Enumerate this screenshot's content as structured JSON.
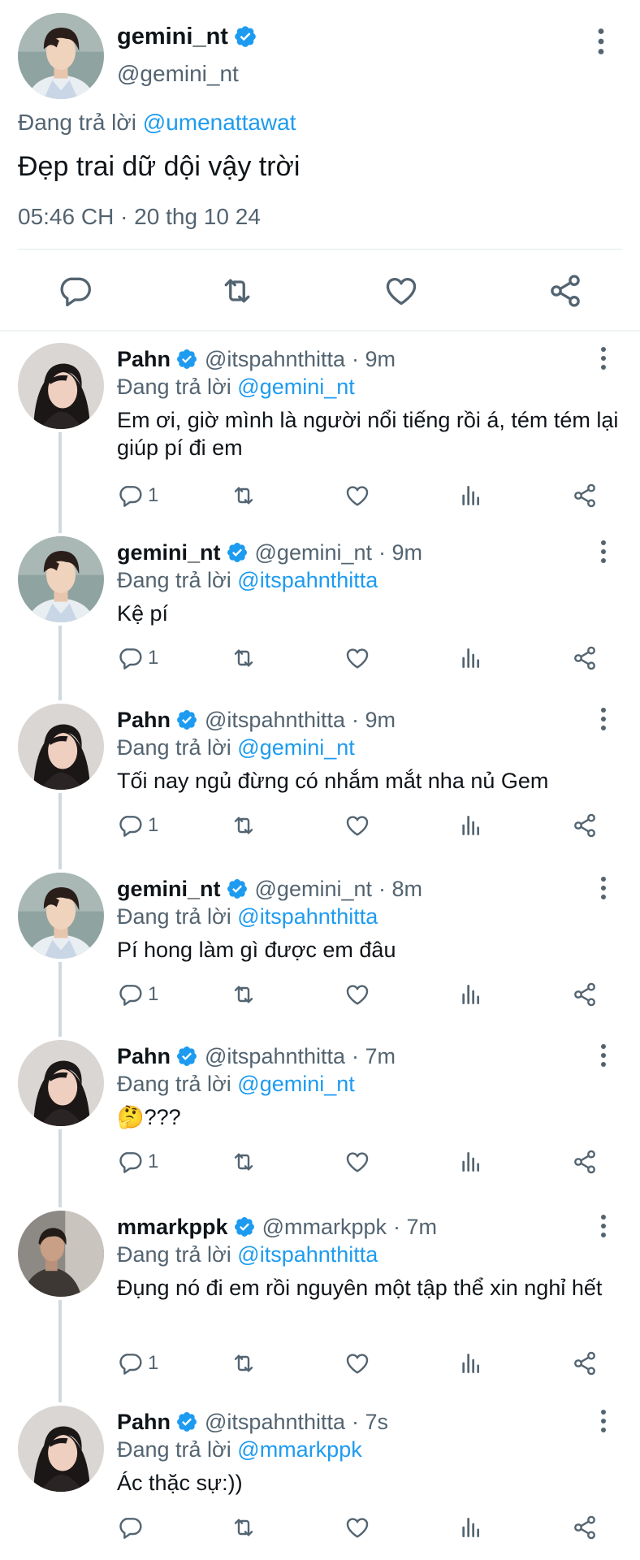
{
  "colors": {
    "accent": "#1d9bf0",
    "muted": "#536471",
    "text": "#0f1419",
    "divider": "#eff3f4"
  },
  "main": {
    "name": "gemini_nt",
    "handle": "@gemini_nt",
    "reply_prefix": "Đang trả lời",
    "reply_to": "@umenattawat",
    "text": "Đẹp trai dữ dội vậy trời",
    "timestamp": "05:46 CH · 20 thg 10 24",
    "actions": [
      "reply-icon",
      "retweet-icon",
      "like-icon",
      "share-icon"
    ]
  },
  "replies": [
    {
      "name": "Pahn",
      "handle": "@itspahnthitta",
      "time": "· 9m",
      "reply_prefix": "Đang trả lời",
      "reply_to": "@gemini_nt",
      "text": "Em ơi, giờ mình là người nổi tiếng rồi á, tém tém lại giúp pí đi em",
      "reply_count": "1",
      "avatar": "pahn"
    },
    {
      "name": "gemini_nt",
      "handle": "@gemini_nt",
      "time": "· 9m",
      "reply_prefix": "Đang trả lời",
      "reply_to": "@itspahnthitta",
      "text": "Kệ pí",
      "reply_count": "1",
      "avatar": "gemini"
    },
    {
      "name": "Pahn",
      "handle": "@itspahnthitta",
      "time": "· 9m",
      "reply_prefix": "Đang trả lời",
      "reply_to": "@gemini_nt",
      "text": "Tối nay ngủ đừng có nhắm mắt nha nủ Gem",
      "reply_count": "1",
      "avatar": "pahn"
    },
    {
      "name": "gemini_nt",
      "handle": "@gemini_nt",
      "time": "· 8m",
      "reply_prefix": "Đang trả lời",
      "reply_to": "@itspahnthitta",
      "text": "Pí hong làm gì được em đâu",
      "reply_count": "1",
      "avatar": "gemini"
    },
    {
      "name": "Pahn",
      "handle": "@itspahnthitta",
      "time": "· 7m",
      "reply_prefix": "Đang trả lời",
      "reply_to": "@gemini_nt",
      "text": "🤔???",
      "reply_count": "1",
      "avatar": "pahn"
    },
    {
      "name": "mmarkppk",
      "handle": "@mmarkppk",
      "time": "· 7m",
      "reply_prefix": "Đang trả lời",
      "reply_to": "@itspahnthitta",
      "text": "Đụng nó đi em rồi nguyên một tập thể xin nghỉ hết",
      "reply_count": "1",
      "avatar": "mark"
    },
    {
      "name": "Pahn",
      "handle": "@itspahnthitta",
      "time": "· 7s",
      "reply_prefix": "Đang trả lời",
      "reply_to": "@mmarkppk",
      "text": "Ác thặc sự:))",
      "reply_count": "",
      "avatar": "pahn"
    }
  ]
}
